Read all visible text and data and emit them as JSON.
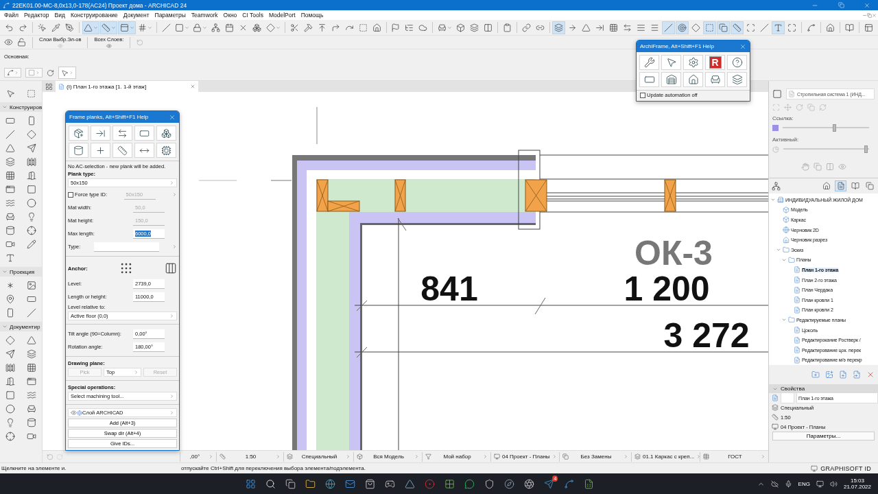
{
  "window": {
    "title": "22EK01.00-MC-8,0x13,0-178(AC24) Проект дома - ARCHICAD 24"
  },
  "menu": [
    "Файл",
    "Редактор",
    "Вид",
    "Конструирование",
    "Документ",
    "Параметры",
    "Teamwork",
    "Окно",
    "CI Tools",
    "ModelPort",
    "Помощь"
  ],
  "main_toolbar": [
    {
      "on": false
    },
    {
      "on": false
    },
    {
      "on": false
    },
    {
      "on": false
    },
    {
      "on": false
    },
    {
      "on": true
    },
    {
      "on": true
    },
    {
      "on": true
    },
    {
      "on": false
    },
    {
      "on": false
    },
    {
      "on": false
    },
    {
      "on": false
    },
    {
      "on": false
    },
    {
      "on": false
    },
    {
      "on": false
    },
    {
      "on": false
    },
    {
      "on": false
    },
    {
      "on": false
    },
    {
      "on": false
    },
    {
      "on": false
    },
    {
      "on": false
    },
    {
      "on": false
    },
    {
      "on": false
    },
    {
      "on": false
    },
    {
      "on": false
    },
    {
      "on": false
    },
    {
      "on": false
    },
    {
      "on": false
    },
    {
      "on": false
    },
    {
      "on": false
    },
    {
      "on": false
    },
    {
      "on": false
    },
    {
      "on": false
    },
    {
      "on": false
    },
    {
      "on": true
    },
    {
      "on": false
    },
    {
      "on": false
    },
    {
      "on": false
    },
    {
      "on": false
    },
    {
      "on": false
    },
    {
      "on": false
    },
    {
      "on": false
    },
    {
      "on": true
    },
    {
      "on": true
    },
    {
      "on": false
    },
    {
      "on": true
    },
    {
      "on": true
    },
    {
      "on": true
    },
    {
      "on": false
    },
    {
      "on": false
    },
    {
      "on": true
    },
    {
      "on": false
    },
    {
      "on": false
    },
    {
      "on": false
    },
    {
      "on": false
    },
    {
      "on": false
    }
  ],
  "layers_toolbar": {
    "selected_label": "Слои Выбр.Эл-ов",
    "all_label": "Всех Слоев:"
  },
  "info_box": {
    "label": "Основная:"
  },
  "toolbox": [
    {
      "title": "Конструиров",
      "expanded": true
    },
    {
      "title": "Проекция",
      "expanded": true
    },
    {
      "title": "Документир",
      "expanded": true
    }
  ],
  "view_tab": {
    "label": "(I) План 1-го этажа [1. 1-й этаж]"
  },
  "canvas": {
    "labels": [
      {
        "kind": "marker",
        "text": "ОК-3"
      },
      {
        "kind": "dimension",
        "text": "841"
      },
      {
        "kind": "dimension",
        "text": "1 200"
      },
      {
        "kind": "dimension",
        "text": "3 272"
      }
    ]
  },
  "frame_planks": {
    "title": "Frame planks, Alt+Shift+F1 Help",
    "message": "No AC-selection - new plank will be added.",
    "plank_type_label": "Plank type:",
    "plank_type": "50x150",
    "force_type_id": {
      "label": "Force type ID:",
      "checked": false,
      "value": "50x150",
      "disabled": true
    },
    "mat_width": {
      "label": "Mat width:",
      "value": "50,0",
      "disabled": true
    },
    "mat_height": {
      "label": "Mat height:",
      "value": "150,0",
      "disabled": true
    },
    "max_length": {
      "label": "Max length:",
      "value": "6000,0"
    },
    "type_label": "Type:",
    "anchor_label": "Anchor:",
    "level": {
      "label": "Level:",
      "value": "2739,0"
    },
    "length": {
      "label": "Length or height:",
      "value": "11000,0"
    },
    "level_relative_label": "Level relative to:",
    "level_relative": "Active floor (0,0)",
    "tilt": {
      "label": "Tilt angle (90=Column):",
      "value": "0,00°"
    },
    "rotation": {
      "label": "Rotation angle:",
      "value": "180,00°"
    },
    "drawing_plane_label": "Drawing plane:",
    "pick": {
      "label": "Pick",
      "disabled": true
    },
    "plane": "Top",
    "reset": {
      "label": "Reset",
      "disabled": true
    },
    "special_label": "Special operations:",
    "machining": "Select machining tool...",
    "layer": "Слой ARCHICAD",
    "buttons": [
      "Add (Alt+3)",
      "Swap dir (Alt+4)",
      "Give IDs..."
    ]
  },
  "archiframe": {
    "title": "ArchiFrame, Alt+Shift+F1 Help",
    "logo": "R",
    "automation": {
      "label": "Update automation off",
      "checked": false
    }
  },
  "right_panel": {
    "view_name": "Стропильная система 1 (ИНД...",
    "sliders": [
      {
        "kind": "swatch",
        "label": "Ссылка:",
        "level": 0.6
      },
      {
        "kind": "pie",
        "label": "Активный:",
        "level": 0.97
      }
    ],
    "nav_tabs": [
      {
        "selected": false
      },
      {
        "selected": true
      },
      {
        "selected": false
      },
      {
        "selected": false
      }
    ],
    "tree": [
      {
        "kind": "project",
        "label": "ИНДИВИДУАЛЬНЫЙ ЖИЛОЙ ДОМ",
        "selected": false,
        "expanded": true,
        "children": [
          {
            "kind": "model",
            "label": "Модель",
            "selected": false
          },
          {
            "kind": "model",
            "label": "Каркас",
            "selected": false
          },
          {
            "kind": "draft",
            "label": "Черновик 2D",
            "selected": false
          },
          {
            "kind": "section",
            "label": "Черновик разрез",
            "selected": false
          },
          {
            "kind": "folder",
            "label": "Эскиз",
            "selected": false,
            "expanded": true,
            "children": [
              {
                "kind": "folder",
                "label": "Планы",
                "selected": false,
                "expanded": true,
                "children": [
                  {
                    "kind": "plan",
                    "label": "План 1-го этажа",
                    "selected": true
                  },
                  {
                    "kind": "plan",
                    "label": "План 2-го этажа",
                    "selected": false
                  },
                  {
                    "kind": "plan",
                    "label": "План Чердака",
                    "selected": false
                  },
                  {
                    "kind": "plan",
                    "label": "План кровли 1",
                    "selected": false
                  },
                  {
                    "kind": "plan",
                    "label": "План кровли 2",
                    "selected": false
                  }
                ]
              },
              {
                "kind": "folder",
                "label": "Редактируемые планы",
                "selected": false,
                "expanded": true,
                "children": [
                  {
                    "kind": "plan",
                    "label": "Цоколь",
                    "selected": false
                  },
                  {
                    "kind": "plan",
                    "label": "Редактирокание Ростверк /",
                    "selected": false
                  },
                  {
                    "kind": "plan",
                    "label": "Редактирование цок. перек",
                    "selected": false
                  },
                  {
                    "kind": "plan",
                    "label": "Редактирование м/э перекр",
                    "selected": false
                  }
                ]
              }
            ]
          }
        ]
      }
    ],
    "properties": {
      "title": "Свойства",
      "expanded": true,
      "name": "План 1-го этажа",
      "rows": [
        "Специальный",
        "1:50",
        "04 Проект - Планы"
      ],
      "button": "Параметры..."
    }
  },
  "status_fields": [
    ",00°",
    "1:50",
    "Специальный",
    "Вся Модель",
    "Мой набор",
    "04 Проект - Планы",
    "Без Замены",
    "01.1 Каркас с креп...",
    "ГОСТ"
  ],
  "status_bar": {
    "hint_start": "Щелкните на элементе и.",
    "hint_end": "отпускайте Ctrl+Shift для переключения выбора элемента/подэлемента.",
    "account": "GRAPHISOFT ID"
  },
  "taskbar": {
    "badge": "4",
    "language": "ENG",
    "time": "15:03",
    "date": "21.07.2022"
  }
}
